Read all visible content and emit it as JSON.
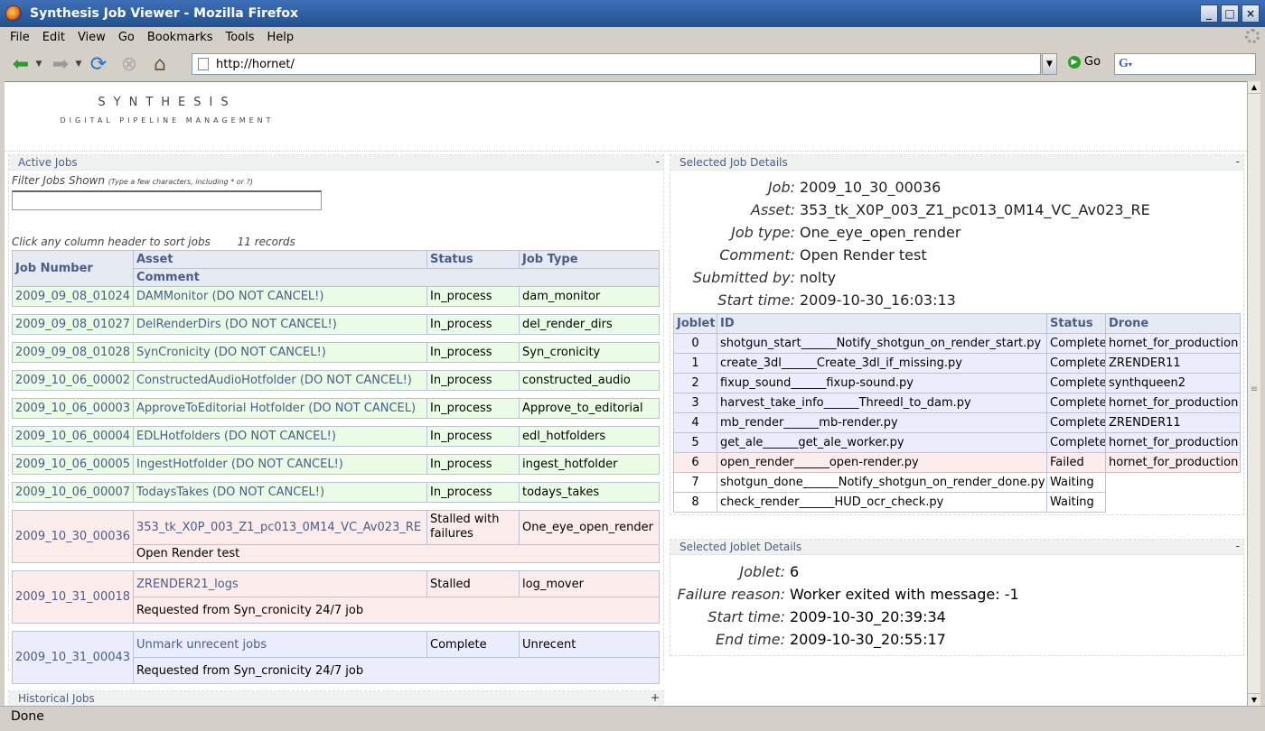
{
  "window": {
    "title": "Synthesis Job Viewer - Mozilla Firefox",
    "btn_min": "_",
    "btn_max": "□",
    "btn_close": "×"
  },
  "menu": [
    "File",
    "Edit",
    "View",
    "Go",
    "Bookmarks",
    "Tools",
    "Help"
  ],
  "nav": {
    "url": "http://hornet/",
    "go_label": "Go",
    "search_placeholder": ""
  },
  "status": "Done",
  "logo": {
    "title": "SYNTHESIS",
    "subtitle": "DIGITAL PIPELINE MANAGEMENT"
  },
  "active_jobs": {
    "header": "Active Jobs",
    "toggle": "-",
    "filter_label": "Filter Jobs Shown",
    "filter_hint": "(Type a few characters, including * or ?)",
    "filter_value": "",
    "sort_hint": "Click any column header to sort jobs",
    "record_count": "11 records",
    "columns": {
      "job_number": "Job Number",
      "asset": "Asset",
      "status": "Status",
      "job_type": "Job Type",
      "comment": "Comment"
    },
    "rows": [
      {
        "job": "2009_09_08_01024",
        "asset": "DAMMonitor (DO NOT CANCEL!)",
        "status": "In_process",
        "type": "dam_monitor",
        "comment": "",
        "color": "#eafbe6"
      },
      {
        "job": "2009_09_08_01027",
        "asset": "DelRenderDirs (DO NOT CANCEL!)",
        "status": "In_process",
        "type": "del_render_dirs",
        "comment": "",
        "color": "#eafbe6"
      },
      {
        "job": "2009_09_08_01028",
        "asset": "SynCronicity (DO NOT CANCEL!)",
        "status": "In_process",
        "type": "Syn_cronicity",
        "comment": "",
        "color": "#eafbe6"
      },
      {
        "job": "2009_10_06_00002",
        "asset": "ConstructedAudioHotfolder (DO NOT CANCEL!)",
        "status": "In_process",
        "type": "constructed_audio",
        "comment": "",
        "color": "#eafbe6"
      },
      {
        "job": "2009_10_06_00003",
        "asset": "ApproveToEditorial Hotfolder (DO NOT CANCEL)",
        "status": "In_process",
        "type": "Approve_to_editorial",
        "comment": "",
        "color": "#eafbe6"
      },
      {
        "job": "2009_10_06_00004",
        "asset": "EDLHotfolders (DO NOT CANCEL!)",
        "status": "In_process",
        "type": "edl_hotfolders",
        "comment": "",
        "color": "#eafbe6"
      },
      {
        "job": "2009_10_06_00005",
        "asset": "IngestHotfolder (DO NOT CANCEL!)",
        "status": "In_process",
        "type": "ingest_hotfolder",
        "comment": "",
        "color": "#eafbe6"
      },
      {
        "job": "2009_10_06_00007",
        "asset": "TodaysTakes (DO NOT CANCEL!)",
        "status": "In_process",
        "type": "todays_takes",
        "comment": "",
        "color": "#eafbe6"
      },
      {
        "job": "2009_10_30_00036",
        "asset": "353_tk_X0P_003_Z1_pc013_0M14_VC_Av023_RE",
        "status": "Stalled with failures",
        "type": "One_eye_open_render",
        "comment": "Open Render test",
        "color": "#fdecec"
      },
      {
        "job": "2009_10_31_00018",
        "asset": "ZRENDER21_logs",
        "status": "Stalled",
        "type": "log_mover",
        "comment": "Requested from Syn_cronicity 24/7 job",
        "color": "#fdecec"
      },
      {
        "job": "2009_10_31_00043",
        "asset": "Unmark unrecent jobs",
        "status": "Complete",
        "type": "Unrecent",
        "comment": "Requested from Syn_cronicity 24/7 job",
        "color": "#ecedfc"
      }
    ]
  },
  "historical_jobs": {
    "header": "Historical Jobs",
    "toggle": "+"
  },
  "job_details": {
    "header": "Selected Job Details",
    "toggle": "-",
    "fields": [
      {
        "k": "Job:",
        "v": "2009_10_30_00036"
      },
      {
        "k": "Asset:",
        "v": "353_tk_X0P_003_Z1_pc013_0M14_VC_Av023_RE"
      },
      {
        "k": "Job type:",
        "v": "One_eye_open_render"
      },
      {
        "k": "Comment:",
        "v": "Open Render test"
      },
      {
        "k": "Submitted by:",
        "v": "nolty"
      },
      {
        "k": "Start time:",
        "v": "2009-10-30_16:03:13"
      }
    ],
    "columns": {
      "joblet": "Joblet",
      "id": "ID",
      "status": "Status",
      "drone": "Drone"
    },
    "joblets": [
      {
        "n": "0",
        "id": "shotgun_start______Notify_shotgun_on_render_start.py",
        "status": "Complete",
        "drone": "hornet_for_production",
        "color": "#ecedfc"
      },
      {
        "n": "1",
        "id": "create_3dl______Create_3dl_if_missing.py",
        "status": "Complete",
        "drone": "ZRENDER11",
        "color": "#ecedfc"
      },
      {
        "n": "2",
        "id": "fixup_sound______fixup-sound.py",
        "status": "Complete",
        "drone": "synthqueen2",
        "color": "#ecedfc"
      },
      {
        "n": "3",
        "id": "harvest_take_info______Threedl_to_dam.py",
        "status": "Complete",
        "drone": "hornet_for_production",
        "color": "#ecedfc"
      },
      {
        "n": "4",
        "id": "mb_render______mb-render.py",
        "status": "Complete",
        "drone": "ZRENDER11",
        "color": "#ecedfc"
      },
      {
        "n": "5",
        "id": "get_ale______get_ale_worker.py",
        "status": "Complete",
        "drone": "hornet_for_production",
        "color": "#ecedfc"
      },
      {
        "n": "6",
        "id": "open_render______open-render.py",
        "status": "Failed",
        "drone": "hornet_for_production",
        "color": "#fdecec"
      },
      {
        "n": "7",
        "id": "shotgun_done______Notify_shotgun_on_render_done.py",
        "status": "Waiting",
        "drone": "",
        "color": "#ffffff"
      },
      {
        "n": "8",
        "id": "check_render______HUD_ocr_check.py",
        "status": "Waiting",
        "drone": "",
        "color": "#ffffff"
      }
    ]
  },
  "joblet_details": {
    "header": "Selected Joblet Details",
    "toggle": "-",
    "fields": [
      {
        "k": "Joblet:",
        "v": "6"
      },
      {
        "k": "Failure reason:",
        "v": "Worker exited with message: -1"
      },
      {
        "k": "Start time:",
        "v": "2009-10-30_20:39:34"
      },
      {
        "k": "End time:",
        "v": "2009-10-30_20:55:17"
      }
    ]
  }
}
